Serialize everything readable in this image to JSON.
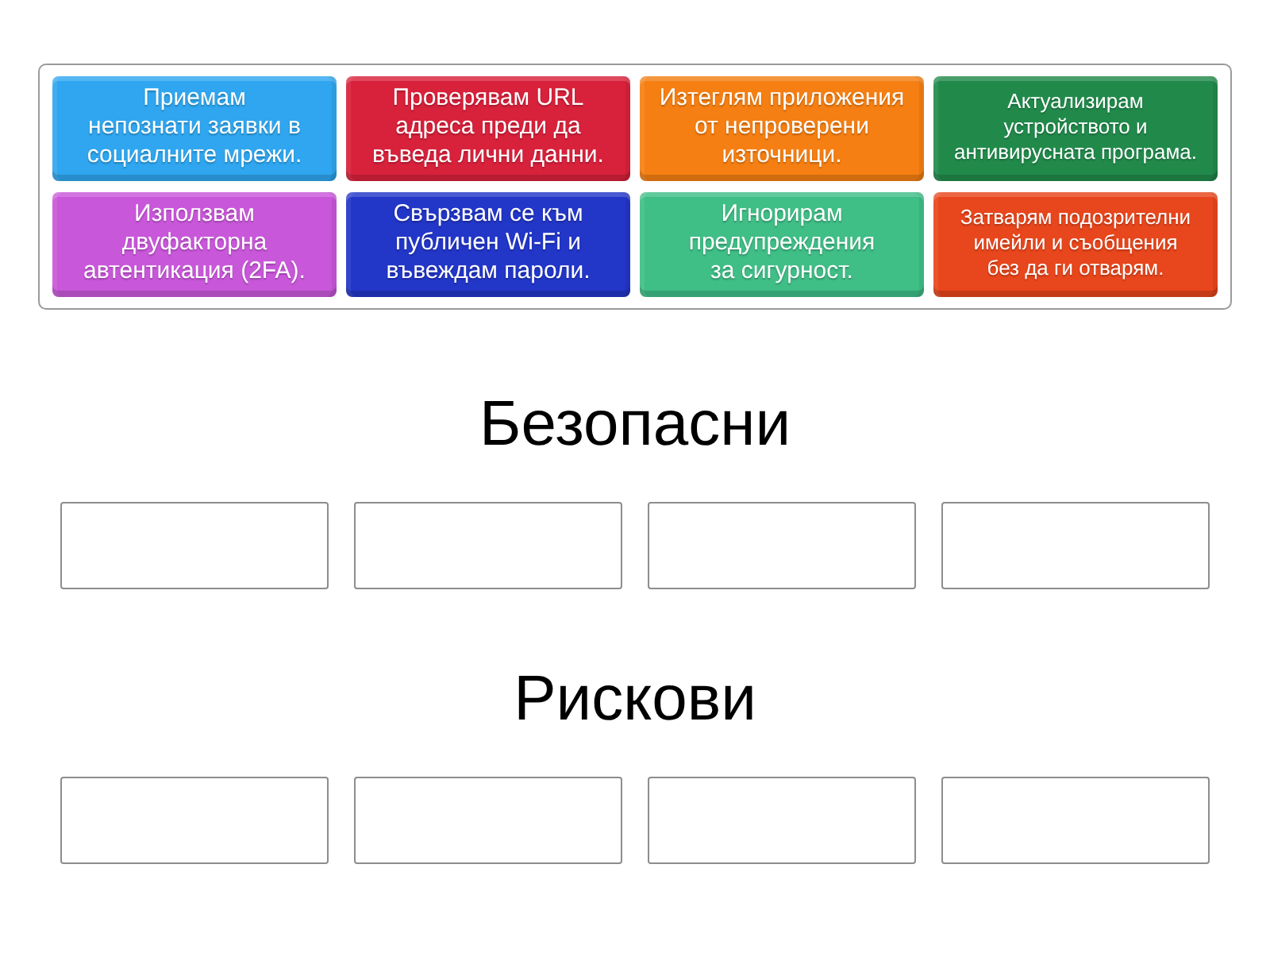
{
  "tiles": [
    {
      "lines": [
        "Приемам",
        "непознати заявки в",
        "социалните мрежи."
      ],
      "color": "#2fa6ef"
    },
    {
      "lines": [
        "Проверявам URL",
        "адреса преди да",
        "въведа лични данни."
      ],
      "color": "#d8213b"
    },
    {
      "lines": [
        "Изтеглям приложения",
        "от непроверени",
        "източници."
      ],
      "color": "#f57f12"
    },
    {
      "lines": [
        "Актуализирам",
        "устройството и",
        "антивирусната програма."
      ],
      "color": "#218a4b"
    },
    {
      "lines": [
        "Използвам",
        "двуфакторна",
        "автентикация (2FA)."
      ],
      "color": "#c957da"
    },
    {
      "lines": [
        "Свързвам се към",
        "публичен Wi-Fi и",
        "въвеждам пароли."
      ],
      "color": "#2236c8"
    },
    {
      "lines": [
        "Игнорирам",
        "предупреждения",
        "за сигурност."
      ],
      "color": "#3fbe86"
    },
    {
      "lines": [
        "Затварям подозрителни",
        "имейли и съобщения",
        "без да ги отварям."
      ],
      "color": "#e8461c"
    }
  ],
  "groups": [
    {
      "title": "Безопасни"
    },
    {
      "title": "Рискови"
    }
  ]
}
